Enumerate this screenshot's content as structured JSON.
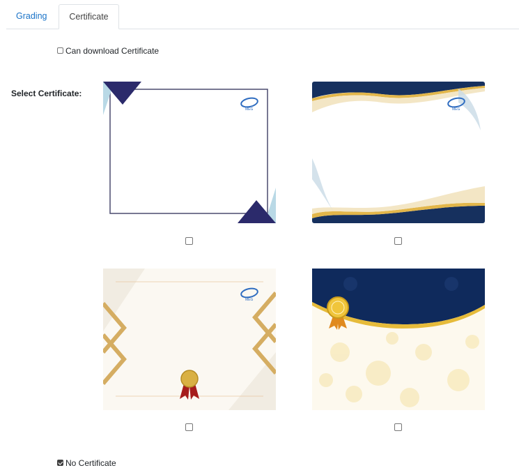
{
  "tabs": [
    {
      "label": "Grading",
      "active": false
    },
    {
      "label": "Certificate",
      "active": true
    }
  ],
  "download_option": {
    "label": "Can download Certificate",
    "checked": false
  },
  "select_label": "Select Certificate:",
  "certificates": [
    {
      "template": "navy-triangle-frame",
      "checked": false
    },
    {
      "template": "blue-gold-wave",
      "checked": false
    },
    {
      "template": "gold-geometric-ribbon",
      "checked": false
    },
    {
      "template": "navy-gold-floral-seal",
      "checked": false
    }
  ],
  "no_certificate": {
    "label": "No Certificate",
    "checked": true
  },
  "colors": {
    "tab_link": "#1a73c8",
    "navy": "#2b2a6b",
    "gold": "#e2b64a"
  }
}
